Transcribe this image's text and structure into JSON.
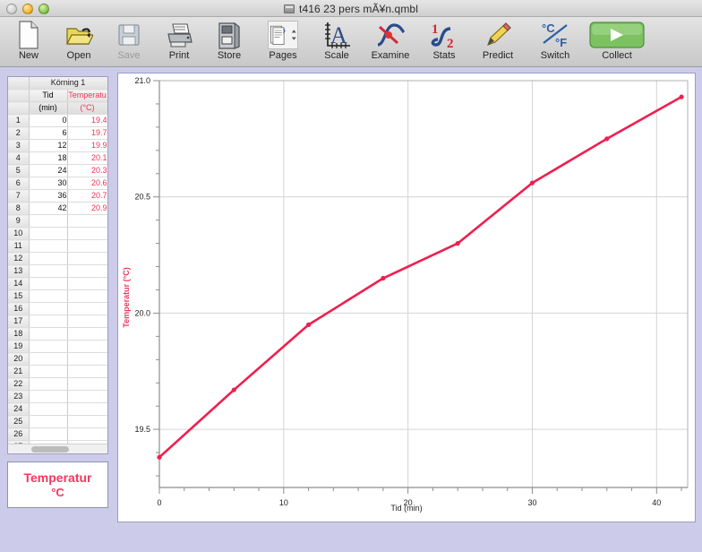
{
  "window": {
    "title": "t416 23 pers mÃ¥n.qmbl",
    "doc_icon": "document-icon",
    "lights": [
      "close",
      "minimize",
      "zoom"
    ]
  },
  "toolbar": {
    "items": [
      {
        "label": "New",
        "icon": "new-document-icon",
        "enabled": true
      },
      {
        "label": "Open",
        "icon": "open-folder-icon",
        "enabled": true
      },
      {
        "label": "Save",
        "icon": "floppy-disk-icon",
        "enabled": false
      },
      {
        "label": "Print",
        "icon": "printer-icon",
        "enabled": true
      },
      {
        "label": "Store",
        "icon": "store-icon",
        "enabled": true
      },
      {
        "label": "Pages",
        "icon": "pages-icon",
        "enabled": true
      },
      {
        "label": "Scale",
        "icon": "scale-axes-icon",
        "enabled": true
      },
      {
        "label": "Examine",
        "icon": "examine-curve-icon",
        "enabled": true
      },
      {
        "label": "Stats",
        "icon": "stats-icon",
        "enabled": true
      },
      {
        "label": "Predict",
        "icon": "pencil-predict-icon",
        "enabled": true
      },
      {
        "label": "Switch",
        "icon": "celsius-fahrenheit-switch-icon",
        "enabled": true
      },
      {
        "label": "Collect",
        "icon": "play-collect-icon",
        "enabled": true
      }
    ]
  },
  "table": {
    "run_header": "Körning 1",
    "columns": [
      {
        "name": "Tid",
        "unit": "(min)",
        "color": "#111111"
      },
      {
        "name": "Temperatu",
        "unit": "(°C)",
        "color": "#ef3355"
      }
    ],
    "row_count": 35,
    "rows": [
      {
        "n": 1,
        "tid": "0",
        "temp": "19.4"
      },
      {
        "n": 2,
        "tid": "6",
        "temp": "19.7"
      },
      {
        "n": 3,
        "tid": "12",
        "temp": "19.9"
      },
      {
        "n": 4,
        "tid": "18",
        "temp": "20.1"
      },
      {
        "n": 5,
        "tid": "24",
        "temp": "20.3"
      },
      {
        "n": 6,
        "tid": "30",
        "temp": "20.6"
      },
      {
        "n": 7,
        "tid": "36",
        "temp": "20.7"
      },
      {
        "n": 8,
        "tid": "42",
        "temp": "20.9"
      }
    ]
  },
  "meter": {
    "title": "Temperatur",
    "unit": "°C",
    "color": "#f1385f"
  },
  "chart_data": {
    "type": "line",
    "title": "",
    "xlabel": "Tid (min)",
    "ylabel": "Temperatur (°C)",
    "xlim": [
      0,
      42.5
    ],
    "ylim": [
      19.25,
      21.0
    ],
    "xticks": [
      0,
      10,
      20,
      30,
      40
    ],
    "xtick_labels": [
      "0",
      "10",
      "20",
      "30",
      "40"
    ],
    "xminor_step": 2,
    "yticks": [
      19.5,
      20.0,
      20.5,
      21.0
    ],
    "ytick_labels": [
      "19.5",
      "20.0",
      "20.5",
      "21.0"
    ],
    "yminor_step": 0.1,
    "grid": true,
    "legend": "none",
    "series": [
      {
        "name": "Temperatur",
        "color": "#f01f4e",
        "marker": "circle",
        "x": [
          0,
          6,
          12,
          18,
          24,
          30,
          36,
          42
        ],
        "y": [
          19.38,
          19.67,
          19.95,
          20.15,
          20.3,
          20.56,
          20.75,
          20.93
        ]
      }
    ]
  }
}
